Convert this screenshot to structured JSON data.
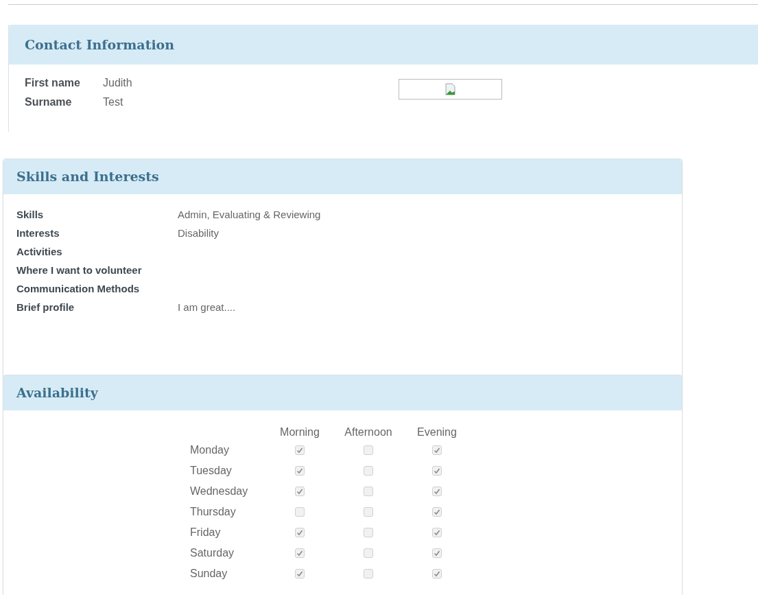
{
  "contact": {
    "title": "Contact Information",
    "fields": [
      {
        "label": "First name",
        "value": "Judith"
      },
      {
        "label": "Surname",
        "value": "Test"
      }
    ]
  },
  "skills": {
    "title": "Skills and Interests",
    "fields": [
      {
        "label": "Skills",
        "value": "Admin, Evaluating & Reviewing"
      },
      {
        "label": "Interests",
        "value": "Disability"
      },
      {
        "label": "Activities"
      },
      {
        "label": "Where I want to volunteer"
      },
      {
        "label": "Communication Methods"
      },
      {
        "label": "Brief profile",
        "value": "I am great...."
      }
    ]
  },
  "availability": {
    "title": "Availability",
    "columns": [
      "Morning",
      "Afternoon",
      "Evening"
    ],
    "rows": [
      {
        "day": "Monday",
        "slots": [
          true,
          false,
          true
        ]
      },
      {
        "day": "Tuesday",
        "slots": [
          true,
          false,
          true
        ]
      },
      {
        "day": "Wednesday",
        "slots": [
          true,
          false,
          true
        ]
      },
      {
        "day": "Thursday",
        "slots": [
          false,
          false,
          true
        ]
      },
      {
        "day": "Friday",
        "slots": [
          true,
          false,
          true
        ]
      },
      {
        "day": "Saturday",
        "slots": [
          true,
          false,
          true
        ]
      },
      {
        "day": "Sunday",
        "slots": [
          true,
          false,
          true
        ]
      }
    ]
  }
}
